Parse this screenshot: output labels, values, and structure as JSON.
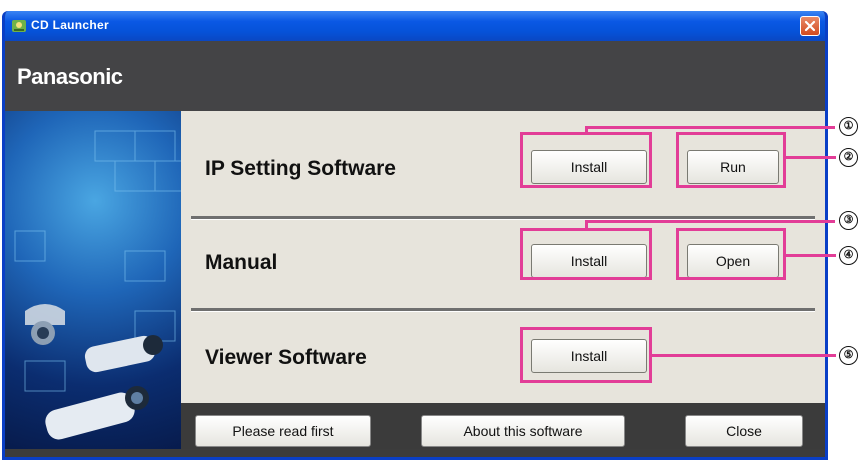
{
  "window": {
    "title": "CD Launcher",
    "brand": "Panasonic"
  },
  "sections": [
    {
      "label": "IP Setting Software",
      "buttons": [
        "Install",
        "Run"
      ]
    },
    {
      "label": "Manual",
      "buttons": [
        "Install",
        "Open"
      ]
    },
    {
      "label": "Viewer Software",
      "buttons": [
        "Install"
      ]
    }
  ],
  "footer": {
    "read_first": "Please read first",
    "about": "About this software",
    "close": "Close"
  },
  "callouts": [
    "①",
    "②",
    "③",
    "④",
    "⑤"
  ],
  "colors": {
    "highlight": "#e23d97",
    "titlebar": "#0a58e4",
    "panel": "#e7e4dc"
  }
}
